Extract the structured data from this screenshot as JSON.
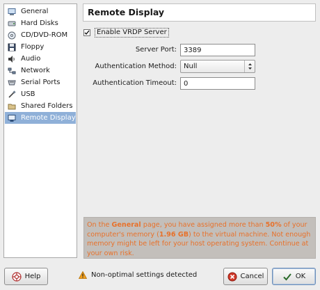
{
  "sidebar": {
    "items": [
      {
        "label": "General",
        "icon": "general-icon",
        "selected": false
      },
      {
        "label": "Hard Disks",
        "icon": "hard-disk-icon",
        "selected": false
      },
      {
        "label": "CD/DVD-ROM",
        "icon": "cd-icon",
        "selected": false
      },
      {
        "label": "Floppy",
        "icon": "floppy-icon",
        "selected": false
      },
      {
        "label": "Audio",
        "icon": "audio-icon",
        "selected": false
      },
      {
        "label": "Network",
        "icon": "network-icon",
        "selected": false
      },
      {
        "label": "Serial Ports",
        "icon": "serial-port-icon",
        "selected": false
      },
      {
        "label": "USB",
        "icon": "usb-icon",
        "selected": false
      },
      {
        "label": "Shared Folders",
        "icon": "folder-icon",
        "selected": false
      },
      {
        "label": "Remote Display",
        "icon": "remote-display-icon",
        "selected": true
      }
    ]
  },
  "panel": {
    "title": "Remote Display",
    "enable_vrdp": {
      "label": "Enable VRDP Server",
      "checked": true
    },
    "server_port": {
      "label": "Server Port:",
      "value": "3389"
    },
    "auth_method": {
      "label": "Authentication Method:",
      "value": "Null"
    },
    "auth_timeout": {
      "label": "Authentication Timeout:",
      "value": "0"
    }
  },
  "warning": {
    "text_1": "On the ",
    "page_name": "General",
    "text_2": " page, you have assigned more than ",
    "percent": "50%",
    "text_3": " of your computer's memory (",
    "memory": "1.96 GB",
    "text_4": ") to the virtual machine. Not enough memory might be left for your host operating system. Continue at your own risk."
  },
  "footer": {
    "help_label": "Help",
    "status_text": "Non-optimal settings detected",
    "cancel_label": "Cancel",
    "ok_label": "OK"
  },
  "colors": {
    "selection": "#8fb0d8",
    "warning_text": "#e8712a",
    "warning_bg": "#c3bfbb"
  }
}
